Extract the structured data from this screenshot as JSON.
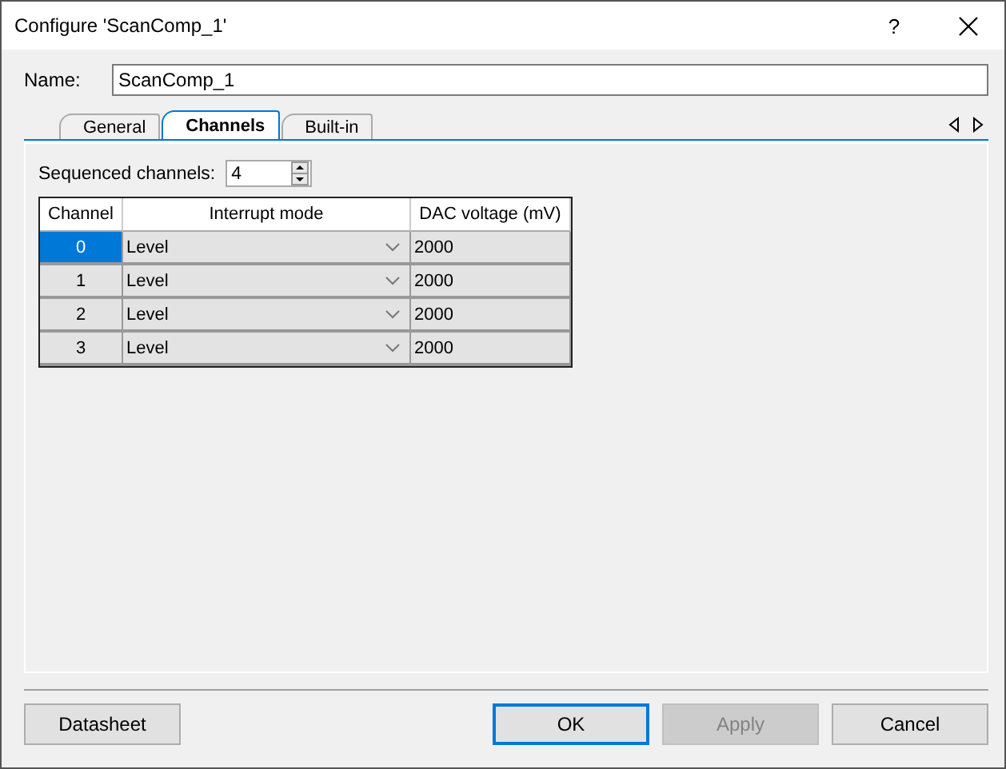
{
  "window": {
    "title": "Configure 'ScanComp_1'",
    "help": "?"
  },
  "name_field": {
    "label": "Name:",
    "value": "ScanComp_1"
  },
  "tabs": [
    {
      "label": "General",
      "selected": false
    },
    {
      "label": "Channels",
      "selected": true
    },
    {
      "label": "Built-in",
      "selected": false
    }
  ],
  "sequenced": {
    "label": "Sequenced channels:",
    "value": "4"
  },
  "table": {
    "columns": [
      "Channel",
      "Interrupt mode",
      "DAC voltage (mV)"
    ],
    "rows": [
      {
        "channel": "0",
        "mode": "Level",
        "voltage": "2000",
        "selected": true
      },
      {
        "channel": "1",
        "mode": "Level",
        "voltage": "2000",
        "selected": false
      },
      {
        "channel": "2",
        "mode": "Level",
        "voltage": "2000",
        "selected": false
      },
      {
        "channel": "3",
        "mode": "Level",
        "voltage": "2000",
        "selected": false
      }
    ]
  },
  "buttons": [
    {
      "label": "Datasheet",
      "disabled": false,
      "focused": false
    },
    {
      "label": "OK",
      "disabled": false,
      "focused": true
    },
    {
      "label": "Apply",
      "disabled": true,
      "focused": false
    },
    {
      "label": "Cancel",
      "disabled": false,
      "focused": false
    }
  ]
}
